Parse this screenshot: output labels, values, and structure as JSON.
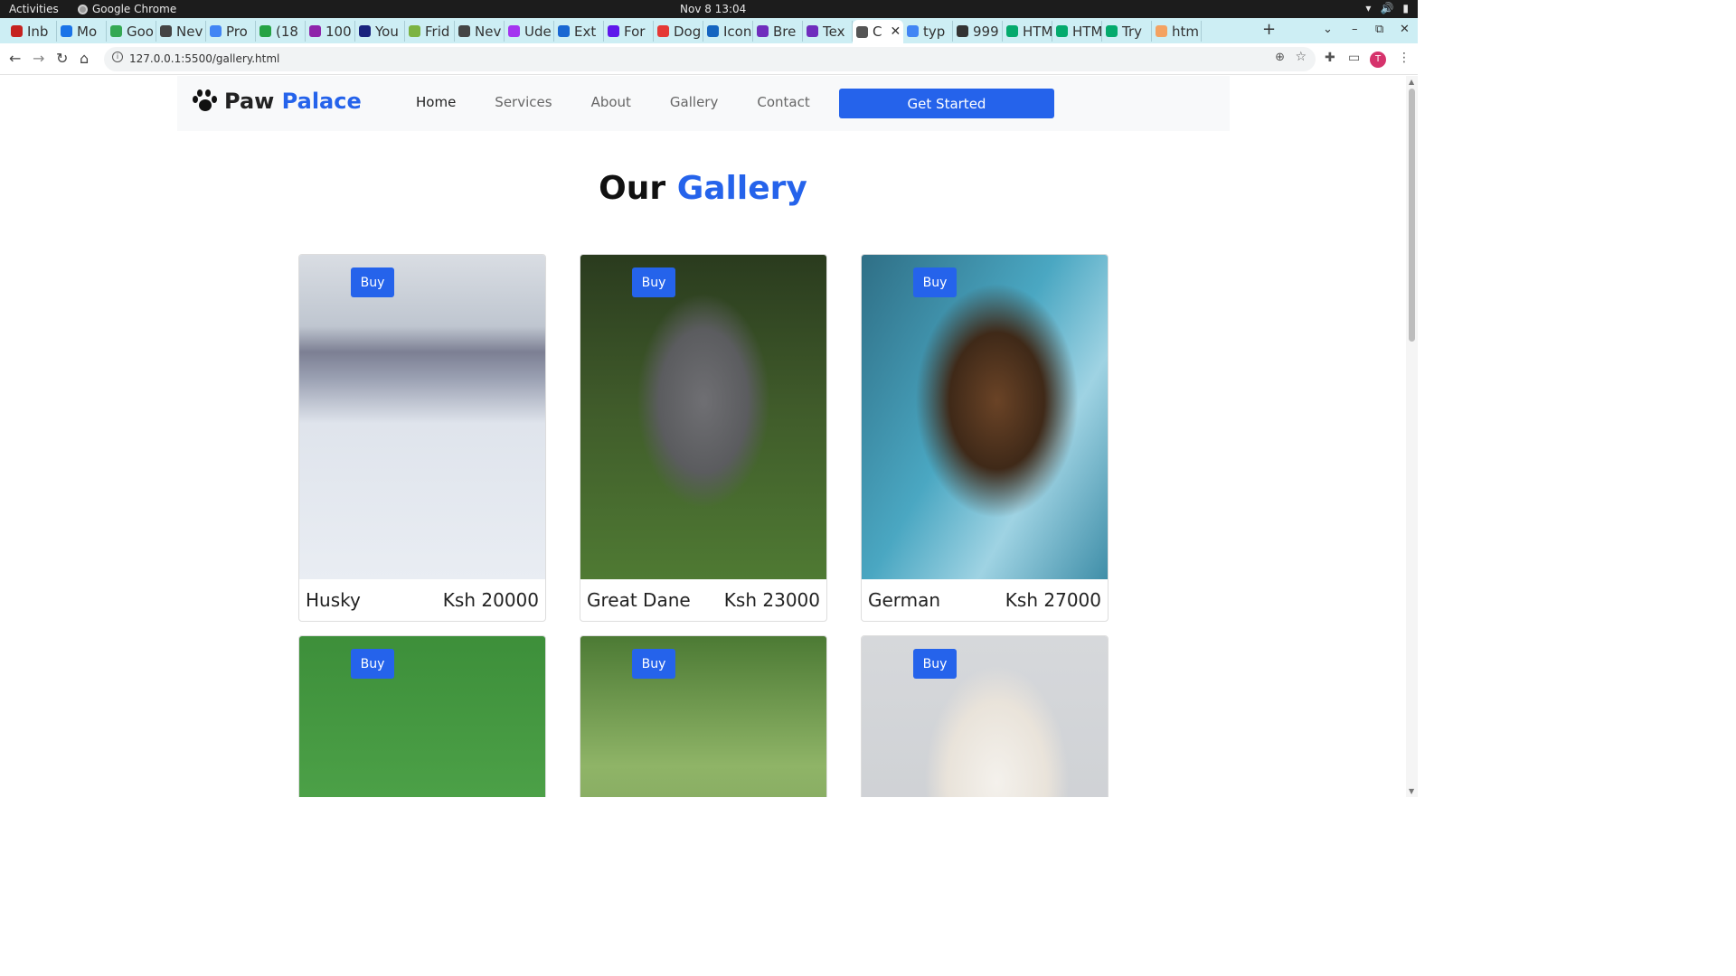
{
  "os_bar": {
    "activities": "Activities",
    "app_name": "Google Chrome",
    "clock": "Nov 8  13:04"
  },
  "tabs": [
    {
      "label": "Inb",
      "color": "#c5221f"
    },
    {
      "label": "Mo",
      "color": "#1a73e8"
    },
    {
      "label": "Goo",
      "color": "#34a853"
    },
    {
      "label": "Nev",
      "color": "#444444"
    },
    {
      "label": "Pro",
      "color": "#4285f4"
    },
    {
      "label": "(18",
      "color": "#25a244"
    },
    {
      "label": "100",
      "color": "#8e24aa"
    },
    {
      "label": "You",
      "color": "#1a237e"
    },
    {
      "label": "Frid",
      "color": "#7cb342"
    },
    {
      "label": "Nev",
      "color": "#444444"
    },
    {
      "label": "Ude",
      "color": "#a435f0"
    },
    {
      "label": "Ext",
      "color": "#1967d2"
    },
    {
      "label": "For",
      "color": "#5e17eb"
    },
    {
      "label": "Dog",
      "color": "#e53935"
    },
    {
      "label": "Icon",
      "color": "#1565c0"
    },
    {
      "label": "Bre",
      "color": "#6f2dbd"
    },
    {
      "label": "Tex",
      "color": "#6f2dbd"
    },
    {
      "label": "C",
      "color": "#555555",
      "active": true
    },
    {
      "label": "typ",
      "color": "#4285f4"
    },
    {
      "label": "999",
      "color": "#333333"
    },
    {
      "label": "HTM",
      "color": "#04aa6d"
    },
    {
      "label": "HTM",
      "color": "#04aa6d"
    },
    {
      "label": "Try",
      "color": "#04aa6d"
    },
    {
      "label": "htm",
      "color": "#f4a261"
    }
  ],
  "address_bar": {
    "url": "127.0.0.1:5500/gallery.html"
  },
  "profile_initial": "T",
  "site": {
    "brand_part1": "Paw",
    "brand_part2": "Palace",
    "nav": [
      "Home",
      "Services",
      "About",
      "Gallery",
      "Contact"
    ],
    "cta_label": "Get Started",
    "heading_part1": "Our",
    "heading_part2": "Gallery",
    "accent_color": "#2563eb"
  },
  "gallery": [
    {
      "name": "Husky",
      "price": "Ksh 20000",
      "buy_label": "Buy"
    },
    {
      "name": "Great Dane",
      "price": "Ksh 23000",
      "buy_label": "Buy"
    },
    {
      "name": "German",
      "price": "Ksh 27000",
      "buy_label": "Buy"
    },
    {
      "name": "",
      "price": "",
      "buy_label": "Buy"
    },
    {
      "name": "",
      "price": "",
      "buy_label": "Buy"
    },
    {
      "name": "",
      "price": "",
      "buy_label": "Buy"
    }
  ]
}
